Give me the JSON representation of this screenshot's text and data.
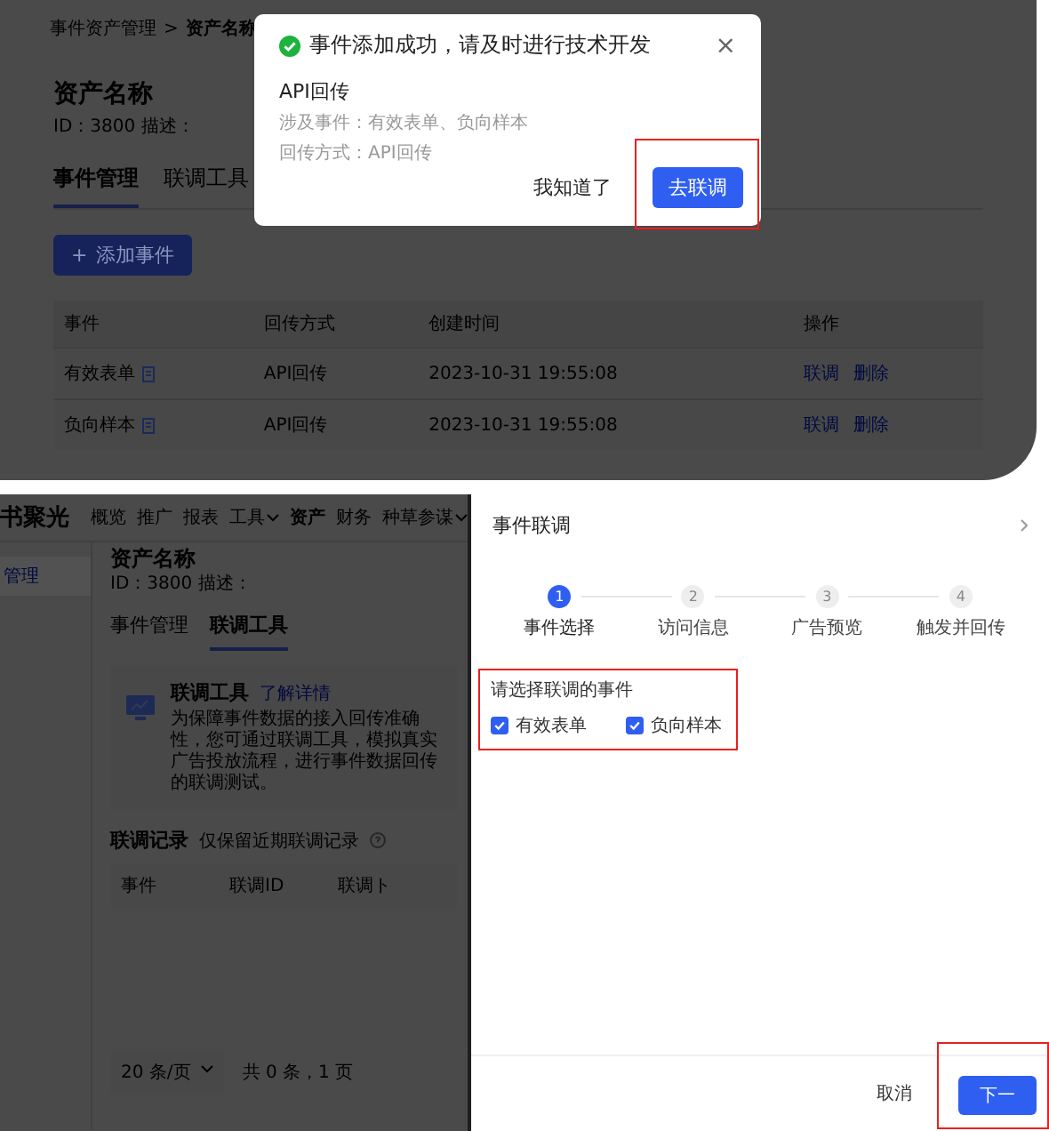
{
  "top_screen": {
    "breadcrumb": {
      "items": [
        "事件资产管理",
        "资产名称"
      ],
      "separator": ">"
    },
    "asset_title": "资产名称",
    "asset_meta": "ID：3800  描述：",
    "tabs": [
      {
        "label": "事件管理",
        "selected": true
      },
      {
        "label": "联调工具",
        "selected": false
      }
    ],
    "add_button": {
      "icon": "+",
      "label": "添加事件"
    },
    "table": {
      "columns": [
        "事件",
        "回传方式",
        "创建时间",
        "操作"
      ],
      "rows": [
        {
          "event": "有效表单",
          "method": "API回传",
          "created": "2023-10-31 19:55:08",
          "actions": [
            "联调",
            "删除"
          ]
        },
        {
          "event": "负向样本",
          "method": "API回传",
          "created": "2023-10-31 19:55:08",
          "actions": [
            "联调",
            "删除"
          ]
        }
      ]
    },
    "modal": {
      "title": "事件添加成功，请及时进行技术开发",
      "close": "×",
      "heading": "API回传",
      "lines": [
        "涉及事件：有效表单、负向样本",
        "回传方式：API回传"
      ],
      "buttons": [
        {
          "label": "我知道了",
          "kind": "text",
          "highlighted": false
        },
        {
          "label": "去联调",
          "kind": "primary",
          "highlighted": true
        }
      ]
    }
  },
  "bottom_screen": {
    "brand": "书聚光",
    "nav": [
      {
        "label": "概览",
        "selected": false,
        "dropdown": false
      },
      {
        "label": "推广",
        "selected": false,
        "dropdown": false
      },
      {
        "label": "报表",
        "selected": false,
        "dropdown": false
      },
      {
        "label": "工具",
        "selected": false,
        "dropdown": true
      },
      {
        "label": "资产",
        "selected": true,
        "dropdown": false
      },
      {
        "label": "财务",
        "selected": false,
        "dropdown": false
      },
      {
        "label": "种草参谋",
        "selected": false,
        "dropdown": true
      }
    ],
    "sidebar": [
      {
        "label": "管理",
        "selected": true
      }
    ],
    "asset_title": "资产名称",
    "asset_meta": "ID：3800  描述：",
    "tabs": [
      {
        "label": "事件管理",
        "selected": false
      },
      {
        "label": "联调工具",
        "selected": true
      }
    ],
    "tool_card": {
      "title": "联调工具",
      "link": "了解详情",
      "description": "为保障事件数据的接入回传准确性，您可通过联调工具，模拟真实广告投放流程，进行事件数据回传的联调测试。"
    },
    "records": {
      "title": "联调记录",
      "hint": "仅保留近期联调记录",
      "columns": [
        "事件",
        "联调ID",
        "联调ト"
      ]
    },
    "pagination": {
      "page_size": "20 条/页",
      "summary": "共 0 条，1 页"
    },
    "drawer": {
      "title": "事件联调",
      "steps": [
        {
          "number": "1",
          "label": "事件选择",
          "selected": true
        },
        {
          "number": "2",
          "label": "访问信息",
          "selected": false
        },
        {
          "number": "3",
          "label": "广告预览",
          "selected": false
        },
        {
          "number": "4",
          "label": "触发并回传",
          "selected": false
        }
      ],
      "section": {
        "title": "请选择联调的事件",
        "highlighted": true,
        "options": [
          {
            "label": "有效表单",
            "checked": true
          },
          {
            "label": "负向样本",
            "checked": true
          }
        ]
      },
      "buttons": [
        {
          "label": "取消",
          "kind": "text",
          "highlighted": false
        },
        {
          "label": "下一",
          "kind": "primary",
          "highlighted": true
        }
      ]
    }
  }
}
